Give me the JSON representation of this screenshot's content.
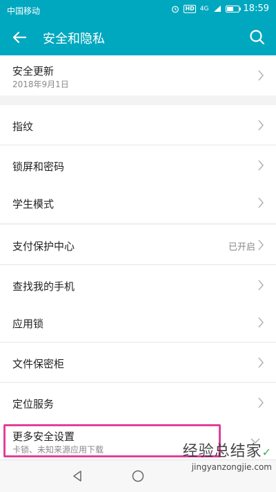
{
  "status_bar": {
    "carrier": "中国移动",
    "hd": "HD",
    "signal": "4G",
    "time": "18:59",
    "battery_level": 0.55
  },
  "app_bar": {
    "title": "安全和隐私",
    "back_icon": "arrow-left-icon",
    "search_icon": "search-icon"
  },
  "sections": [
    {
      "rows": [
        {
          "label": "安全更新",
          "sub": "2018年9月1日"
        }
      ]
    },
    {
      "rows": [
        {
          "label": "指纹"
        },
        {
          "label": "锁屏和密码"
        }
      ]
    },
    {
      "rows": [
        {
          "label": "学生模式"
        }
      ]
    },
    {
      "rows": [
        {
          "label": "支付保护中心",
          "value": "已开启"
        },
        {
          "label": "查找我的手机"
        }
      ]
    },
    {
      "rows": [
        {
          "label": "应用锁"
        },
        {
          "label": "文件保密柜"
        },
        {
          "label": "定位服务"
        }
      ]
    },
    {
      "rows": [
        {
          "label": "更多安全设置",
          "sub": "卡锁、未知来源应用下载"
        }
      ]
    }
  ],
  "highlight_color": "#e0409a",
  "accent_color": "#00a8bf",
  "watermark": {
    "text": "经验总结家",
    "url": "jingyanzongjie.com"
  }
}
